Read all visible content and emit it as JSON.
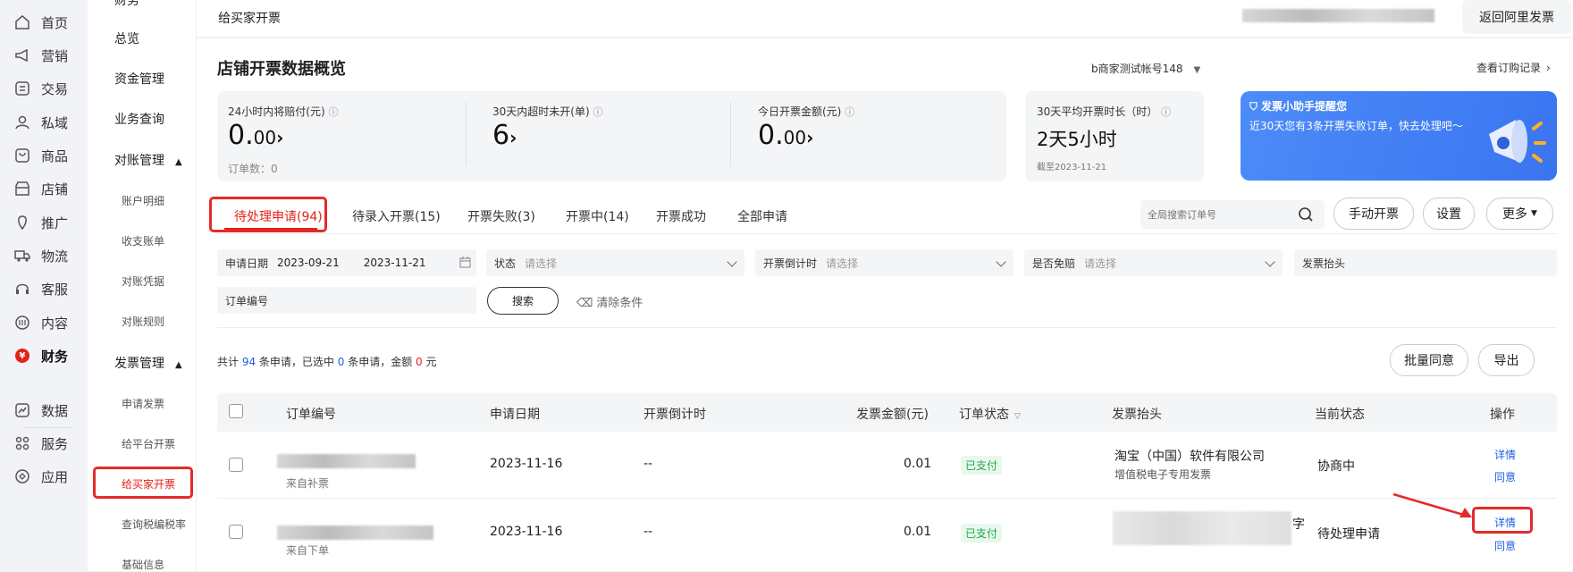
{
  "left_nav": [
    {
      "label": "首页",
      "icon": "home-icon"
    },
    {
      "label": "营销",
      "icon": "megaphone-icon"
    },
    {
      "label": "交易",
      "icon": "transaction-icon"
    },
    {
      "label": "私域",
      "icon": "users-icon"
    },
    {
      "label": "商品",
      "icon": "goods-icon"
    },
    {
      "label": "店铺",
      "icon": "store-icon"
    },
    {
      "label": "推广",
      "icon": "promotion-icon"
    },
    {
      "label": "物流",
      "icon": "truck-icon"
    },
    {
      "label": "客服",
      "icon": "headset-icon"
    },
    {
      "label": "内容",
      "icon": "content-icon"
    },
    {
      "label": "财务",
      "icon": "finance-icon"
    },
    {
      "label": "数据",
      "icon": "chart-icon"
    },
    {
      "label": "服务",
      "icon": "grid-icon"
    },
    {
      "label": "应用",
      "icon": "app-icon"
    }
  ],
  "finance_badge": "¥",
  "sub_nav": {
    "top_cut": "财务",
    "items": [
      "总览",
      "资金管理",
      "业务查询"
    ],
    "group1": "对账管理",
    "group1_items": [
      "账户明细",
      "收支账单",
      "对账凭据",
      "对账规则"
    ],
    "group2": "发票管理",
    "group2_items": [
      "申请发票",
      "给平台开票",
      "给买家开票",
      "查询税编税率",
      "基础信息"
    ]
  },
  "header": {
    "title": "给买家开票",
    "back_button": "返回阿里发票"
  },
  "overview": {
    "title": "店铺开票数据概览",
    "account": "b商家测试帐号148",
    "subscription_link": "查看订购记录",
    "stats": [
      {
        "label": "24小时内将赔付(元)",
        "value_int": "0.",
        "value_dec": "00",
        "sub": "订单数：0"
      },
      {
        "label": "30天内超时未开(单)",
        "value_int": "6",
        "value_dec": "",
        "sub": ""
      },
      {
        "label": "今日开票金额(元)",
        "value_int": "0.",
        "value_dec": "00",
        "sub": ""
      }
    ],
    "avg": {
      "label": "30天平均开票时长（时）",
      "value": "2天5小时",
      "date": "截至2023-11-21"
    },
    "reminder": {
      "title": "发票小助手提醒您",
      "text": "近30天您有3条开票失败订单，快去处理吧～"
    }
  },
  "tabs": [
    "待处理申请(94)",
    "待录入开票(15)",
    "开票失败(3)",
    "开票中(14)",
    "开票成功",
    "全部申请"
  ],
  "search": {
    "placeholder": "全局搜索订单号"
  },
  "actions": {
    "manual": "手动开票",
    "settings": "设置",
    "more": "更多"
  },
  "filters": {
    "date_label": "申请日期",
    "date_start": "2023-09-21",
    "date_end": "2023-11-21",
    "status_label": "状态",
    "status_ph": "请选择",
    "countdown_label": "开票倒计时",
    "countdown_ph": "请选择",
    "exempt_label": "是否免赔",
    "exempt_ph": "请选择",
    "title_label": "发票抬头",
    "order_label": "订单编号",
    "search_btn": "搜索",
    "clear": "清除条件"
  },
  "summary": {
    "p1": "共计 ",
    "total": "94",
    "p2": " 条申请，已选中 ",
    "selected": "0",
    "p3": " 条申请，金额 ",
    "amount": "0",
    "p4": " 元"
  },
  "bulk": {
    "approve": "批量同意",
    "export": "导出"
  },
  "table": {
    "headers": [
      "订单编号",
      "申请日期",
      "开票倒计时",
      "发票金额(元)",
      "订单状态",
      "发票抬头",
      "当前状态",
      "操作"
    ],
    "rows": [
      {
        "source": "来自补票",
        "date": "2023-11-16",
        "countdown": "--",
        "amount": "0.01",
        "order_status": "已支付",
        "title": "淘宝（中国）软件有限公司",
        "title_sub": "增值税电子专用发票",
        "current": "协商中",
        "detail": "详情",
        "agree": "同意"
      },
      {
        "source": "来自下单",
        "date": "2023-11-16",
        "countdown": "--",
        "amount": "0.01",
        "order_status": "已支付",
        "title_tail": "字",
        "current": "待处理申请",
        "detail": "详情",
        "agree": "同意"
      }
    ]
  },
  "colors": {
    "accent": "#e2231a",
    "link": "#1f5fe0",
    "highlight": "#e52a2a",
    "banner": "#3a7cf6"
  }
}
